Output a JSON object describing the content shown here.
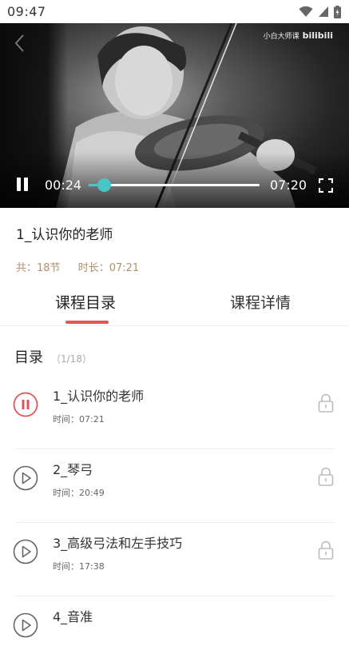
{
  "status_bar": {
    "time": "09:47"
  },
  "player": {
    "watermark_text": "小白大师课",
    "watermark_brand": "bilibili",
    "current_time": "00:24",
    "total_time": "07:20",
    "progress_fraction": 0.09,
    "accent_color": "#46c6c6"
  },
  "course": {
    "title": "1_认识你的老师",
    "count_text": "共：18节",
    "duration_text": "时长：07:21"
  },
  "tabs": [
    {
      "label": "课程目录",
      "active": true
    },
    {
      "label": "课程详情",
      "active": false
    }
  ],
  "tab_indicator_color": "#e0555a",
  "catalog": {
    "heading": "目录",
    "count": "（1/18）",
    "lessons": [
      {
        "title": "1_认识你的老师",
        "duration": "时间：07:21",
        "status": "playing",
        "icon": "pause-circle-icon",
        "locked": true
      },
      {
        "title": "2_琴弓",
        "duration": "时间：20:49",
        "status": "idle",
        "icon": "play-circle-icon",
        "locked": true
      },
      {
        "title": "3_高级弓法和左手技巧",
        "duration": "时间：17:38",
        "status": "idle",
        "icon": "play-circle-icon",
        "locked": true
      },
      {
        "title": "4_音准",
        "duration": "",
        "status": "idle",
        "icon": "play-circle-icon",
        "locked": true
      }
    ]
  }
}
